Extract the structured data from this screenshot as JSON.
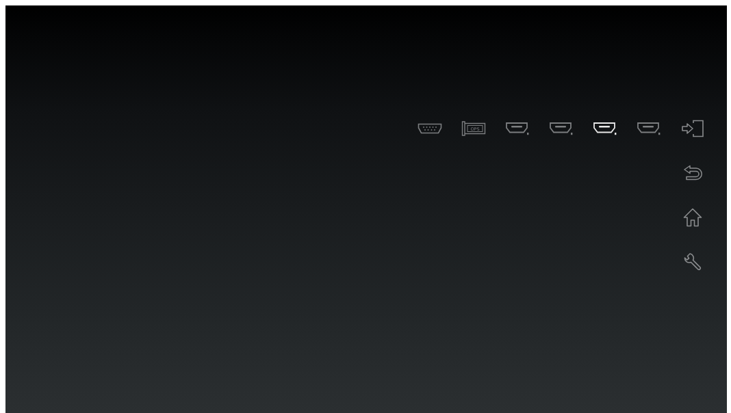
{
  "sources": [
    {
      "kind": "vga",
      "selected": false
    },
    {
      "kind": "ops",
      "label": "OPS",
      "selected": false
    },
    {
      "kind": "hdmi",
      "selected": false
    },
    {
      "kind": "hdmi",
      "selected": false
    },
    {
      "kind": "hdmi",
      "selected": true
    },
    {
      "kind": "hdmi",
      "selected": false
    }
  ],
  "menu": [
    {
      "kind": "input"
    },
    {
      "kind": "back"
    },
    {
      "kind": "home"
    },
    {
      "kind": "settings"
    }
  ]
}
